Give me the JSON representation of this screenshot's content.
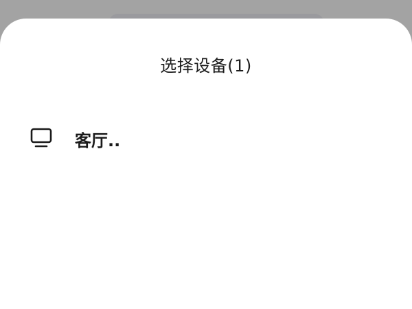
{
  "dialog": {
    "title": "选择设备(1)"
  },
  "devices": [
    {
      "name": "客厅..",
      "icon": "tv-icon"
    }
  ]
}
